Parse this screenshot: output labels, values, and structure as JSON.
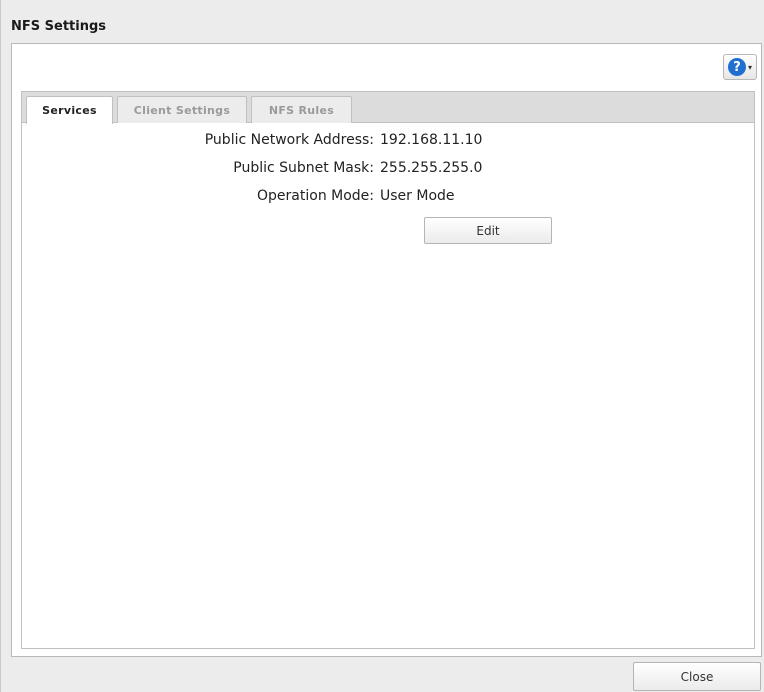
{
  "dialog": {
    "title": "NFS Settings",
    "close_label": "Close"
  },
  "help": {
    "icon": "help-icon",
    "glyph": "?",
    "caret": "▾"
  },
  "tabs": [
    {
      "label": "Services",
      "active": true
    },
    {
      "label": "Client Settings",
      "active": false
    },
    {
      "label": "NFS Rules",
      "active": false
    }
  ],
  "services": {
    "public_network_address": {
      "label": "Public Network Address:",
      "value": "192.168.11.10"
    },
    "public_subnet_mask": {
      "label": "Public Subnet Mask:",
      "value": "255.255.255.0"
    },
    "operation_mode": {
      "label": "Operation Mode:",
      "value": "User Mode"
    },
    "edit_label": "Edit"
  }
}
